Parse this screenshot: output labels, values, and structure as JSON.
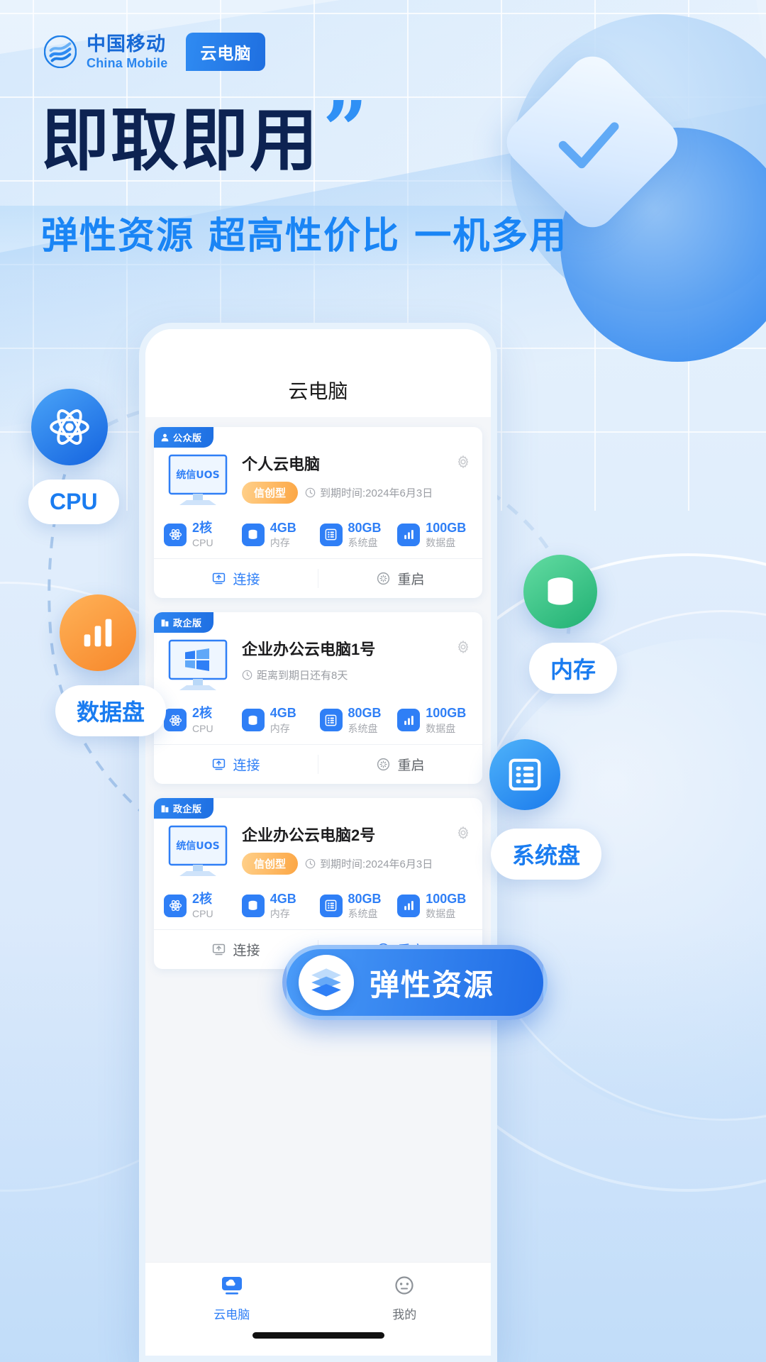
{
  "brand": {
    "name_cn": "中国移动",
    "name_en": "China Mobile",
    "tag": "云电脑",
    "logo_icon": "china-mobile-logo-icon"
  },
  "hero": {
    "headline": "即取即用",
    "quote_mark": "”",
    "subline": "弹性资源 超高性价比 一机多用"
  },
  "phone": {
    "app_title": "云电脑",
    "cards": [
      {
        "badge": "公众版",
        "badge_icon": "user-icon",
        "os_logo": "统信UOS",
        "name": "个人云电脑",
        "type_tag": "信创型",
        "expiry_icon": "clock-icon",
        "expiry": "到期时间:2024年6月3日",
        "gear_icon": "gear-icon",
        "specs": [
          {
            "value": "2核",
            "label": "CPU",
            "icon": "cpu-icon"
          },
          {
            "value": "4GB",
            "label": "内存",
            "icon": "memory-icon"
          },
          {
            "value": "80GB",
            "label": "系统盘",
            "icon": "system-disk-icon"
          },
          {
            "value": "100GB",
            "label": "数据盘",
            "icon": "data-disk-icon"
          }
        ],
        "actions": {
          "connect": "连接",
          "connect_icon": "connect-icon",
          "restart": "重启",
          "restart_icon": "restart-icon",
          "restart_active": false
        }
      },
      {
        "badge": "政企版",
        "badge_icon": "building-icon",
        "os_logo": "windows-logo-icon",
        "name": "企业办公云电脑1号",
        "type_tag": "",
        "expiry_icon": "clock-icon",
        "expiry": "距离到期日还有8天",
        "gear_icon": "gear-icon",
        "specs": [
          {
            "value": "2核",
            "label": "CPU",
            "icon": "cpu-icon"
          },
          {
            "value": "4GB",
            "label": "内存",
            "icon": "memory-icon"
          },
          {
            "value": "80GB",
            "label": "系统盘",
            "icon": "system-disk-icon"
          },
          {
            "value": "100GB",
            "label": "数据盘",
            "icon": "data-disk-icon"
          }
        ],
        "actions": {
          "connect": "连接",
          "connect_icon": "connect-icon",
          "restart": "重启",
          "restart_icon": "restart-icon",
          "restart_active": false
        }
      },
      {
        "badge": "政企版",
        "badge_icon": "building-icon",
        "os_logo": "统信UOS",
        "name": "企业办公云电脑2号",
        "type_tag": "信创型",
        "expiry_icon": "clock-icon",
        "expiry": "到期时间:2024年6月3日",
        "gear_icon": "gear-icon",
        "specs": [
          {
            "value": "2核",
            "label": "CPU",
            "icon": "cpu-icon"
          },
          {
            "value": "4GB",
            "label": "内存",
            "icon": "memory-icon"
          },
          {
            "value": "80GB",
            "label": "系统盘",
            "icon": "system-disk-icon"
          },
          {
            "value": "100GB",
            "label": "数据盘",
            "icon": "data-disk-icon"
          }
        ],
        "actions": {
          "connect": "连接",
          "connect_icon": "connect-icon",
          "restart": "重启",
          "restart_icon": "restart-icon",
          "restart_active": true
        }
      }
    ],
    "tabbar": [
      {
        "label": "云电脑",
        "icon": "cloud-pc-icon",
        "active": true
      },
      {
        "label": "我的",
        "icon": "profile-icon",
        "active": false
      }
    ]
  },
  "callouts": [
    {
      "label": "CPU",
      "icon": "cpu-icon",
      "color": "#1463df"
    },
    {
      "label": "数据盘",
      "icon": "data-disk-icon",
      "color": "#f7872a"
    },
    {
      "label": "内存",
      "icon": "memory-icon",
      "color": "#20b073"
    },
    {
      "label": "系统盘",
      "icon": "system-disk-icon",
      "color": "#1b7bec"
    }
  ],
  "elastic_banner": {
    "label": "弹性资源",
    "icon": "layers-icon"
  },
  "colors": {
    "primary_blue": "#2f7ff6",
    "deep_navy": "#0d2352",
    "bright_blue": "#1a85f5",
    "orange": "#f7872a",
    "green": "#20b073"
  }
}
